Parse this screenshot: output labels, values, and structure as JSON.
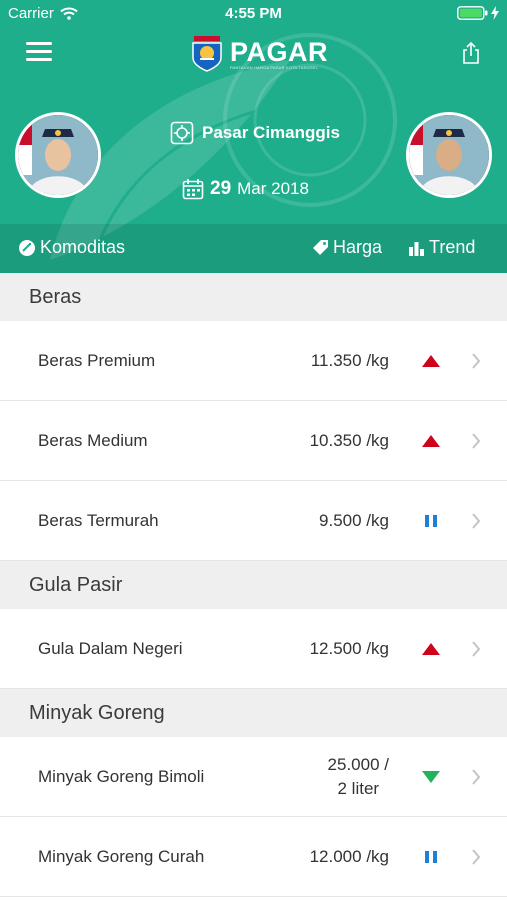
{
  "status": {
    "carrier": "Carrier",
    "time": "4:55 PM"
  },
  "app": {
    "brand": "PAGAR",
    "tagline": "PANTAUAN HARGA PASAR KOTA TANGSEL"
  },
  "market": {
    "name": "Pasar Cimanggis"
  },
  "date": {
    "day": "29",
    "month_year": "Mar 2018"
  },
  "columns": {
    "komoditas": "Komoditas",
    "harga": "Harga",
    "trend": "Trend"
  },
  "colors": {
    "header": "#1fae8c",
    "up": "#d0021b",
    "down": "#21b35a",
    "flat": "#1d7fd6"
  },
  "sections": [
    {
      "title": "Beras",
      "items": [
        {
          "name": "Beras Premium",
          "price": "11.350 /kg",
          "trend": "up"
        },
        {
          "name": "Beras Medium",
          "price": "10.350 /kg",
          "trend": "up"
        },
        {
          "name": "Beras Termurah",
          "price": "9.500 /kg",
          "trend": "flat"
        }
      ]
    },
    {
      "title": "Gula Pasir",
      "items": [
        {
          "name": "Gula Dalam Negeri",
          "price": "12.500 /kg",
          "trend": "up"
        }
      ]
    },
    {
      "title": "Minyak Goreng",
      "items": [
        {
          "name": "Minyak Goreng Bimoli",
          "price": "25.000 /",
          "price2": "2 liter",
          "trend": "down"
        },
        {
          "name": "Minyak Goreng Curah",
          "price": "12.000 /kg",
          "trend": "flat"
        }
      ]
    }
  ]
}
